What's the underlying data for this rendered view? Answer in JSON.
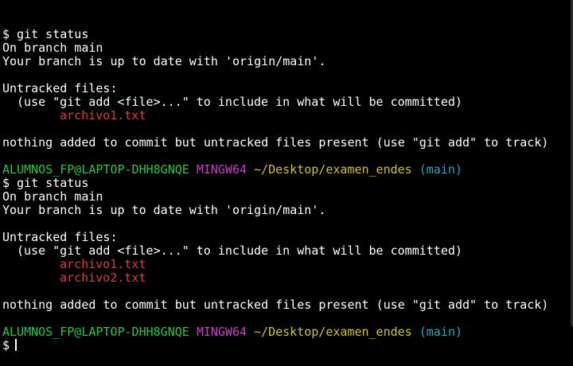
{
  "terminal": {
    "lines": [
      {
        "type": "cmd",
        "text": "$ git status"
      },
      {
        "type": "out",
        "text": "On branch main"
      },
      {
        "type": "out",
        "text": "Your branch is up to date with 'origin/main'."
      },
      {
        "type": "blank",
        "text": ""
      },
      {
        "type": "out",
        "text": "Untracked files:"
      },
      {
        "type": "out-indent",
        "text": "(use \"git add <file>...\" to include in what will be committed)"
      },
      {
        "type": "file",
        "text": "archivo1.txt"
      },
      {
        "type": "blank",
        "text": ""
      },
      {
        "type": "out",
        "text": "nothing added to commit but untracked files present (use \"git add\" to track)"
      },
      {
        "type": "blank",
        "text": ""
      },
      {
        "type": "prompt",
        "user": "ALUMNOS_FP@LAPTOP-DHH8GNQE",
        "shell": "MINGW64",
        "path": "~/Desktop/examen_endes",
        "branch": "(main)"
      },
      {
        "type": "cmd",
        "text": "$ git status"
      },
      {
        "type": "out",
        "text": "On branch main"
      },
      {
        "type": "out",
        "text": "Your branch is up to date with 'origin/main'."
      },
      {
        "type": "blank",
        "text": ""
      },
      {
        "type": "out",
        "text": "Untracked files:"
      },
      {
        "type": "out-indent",
        "text": "(use \"git add <file>...\" to include in what will be committed)"
      },
      {
        "type": "file",
        "text": "archivo1.txt"
      },
      {
        "type": "file",
        "text": "archivo2.txt"
      },
      {
        "type": "blank",
        "text": ""
      },
      {
        "type": "out",
        "text": "nothing added to commit but untracked files present (use \"git add\" to track)"
      },
      {
        "type": "blank",
        "text": ""
      },
      {
        "type": "prompt",
        "user": "ALUMNOS_FP@LAPTOP-DHH8GNQE",
        "shell": "MINGW64",
        "path": "~/Desktop/examen_endes",
        "branch": "(main)"
      },
      {
        "type": "input",
        "text": "$"
      }
    ]
  },
  "colors": {
    "background": "#000000",
    "foreground": "#ffffff",
    "untracked_file": "#d83c3c",
    "user_host": "#2ec44a",
    "shell": "#c043c0",
    "path": "#d1c23a",
    "branch": "#2ea6b8"
  }
}
